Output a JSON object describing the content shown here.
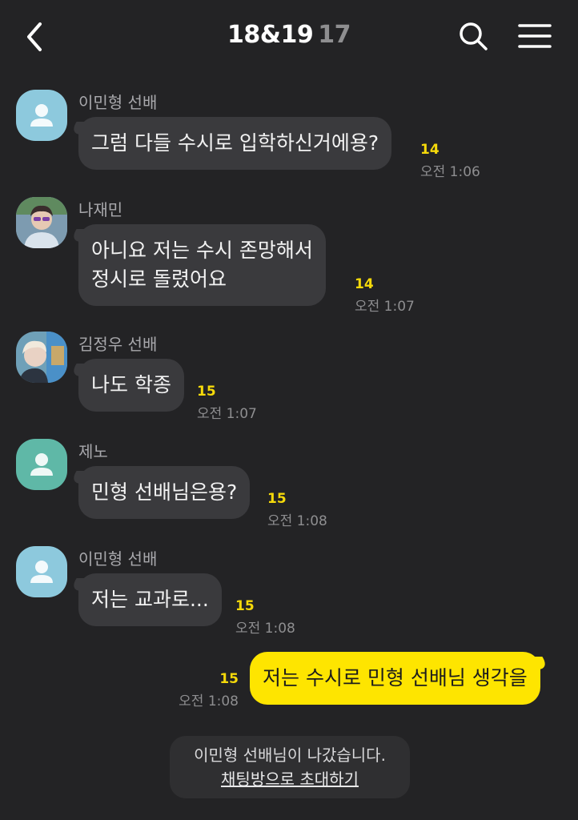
{
  "header": {
    "title": "18&19",
    "member_count": "17",
    "back_icon": "chevron-left-icon",
    "search_icon": "search-icon",
    "menu_icon": "hamburger-menu-icon"
  },
  "colors": {
    "background": "#232325",
    "bubble_other": "#3a3a3d",
    "bubble_mine": "#fee500",
    "unread": "#f5d90a",
    "timestamp": "#8e8e90"
  },
  "messages": [
    {
      "sender": "이민형 선배",
      "avatar": "default-profile-icon",
      "lines": [
        "그럼 다들 수시로 입학하신거에용?"
      ],
      "unread": "14",
      "time": "오전 1:06"
    },
    {
      "sender": "나재민",
      "avatar": "profile-photo",
      "lines": [
        "아니요 저는 수시 존망해서",
        "정시로 돌렸어요"
      ],
      "unread": "14",
      "time": "오전 1:07"
    },
    {
      "sender": "김정우 선배",
      "avatar": "profile-photo",
      "lines": [
        "나도 학종"
      ],
      "unread": "15",
      "time": "오전 1:07"
    },
    {
      "sender": "제노",
      "avatar": "default-profile-icon",
      "lines": [
        "민형 선배님은용?"
      ],
      "unread": "15",
      "time": "오전 1:08"
    },
    {
      "sender": "이민형 선배",
      "avatar": "default-profile-icon",
      "lines": [
        "저는 교과로..."
      ],
      "unread": "15",
      "time": "오전 1:08"
    }
  ],
  "my_message": {
    "lines": [
      "저는 수시로 민형 선배님 생각을"
    ],
    "unread": "15",
    "time": "오전 1:08"
  },
  "system_notice": {
    "text": "이민형 선배님이 나갔습니다.",
    "invite_link": "채팅방으로 초대하기"
  }
}
